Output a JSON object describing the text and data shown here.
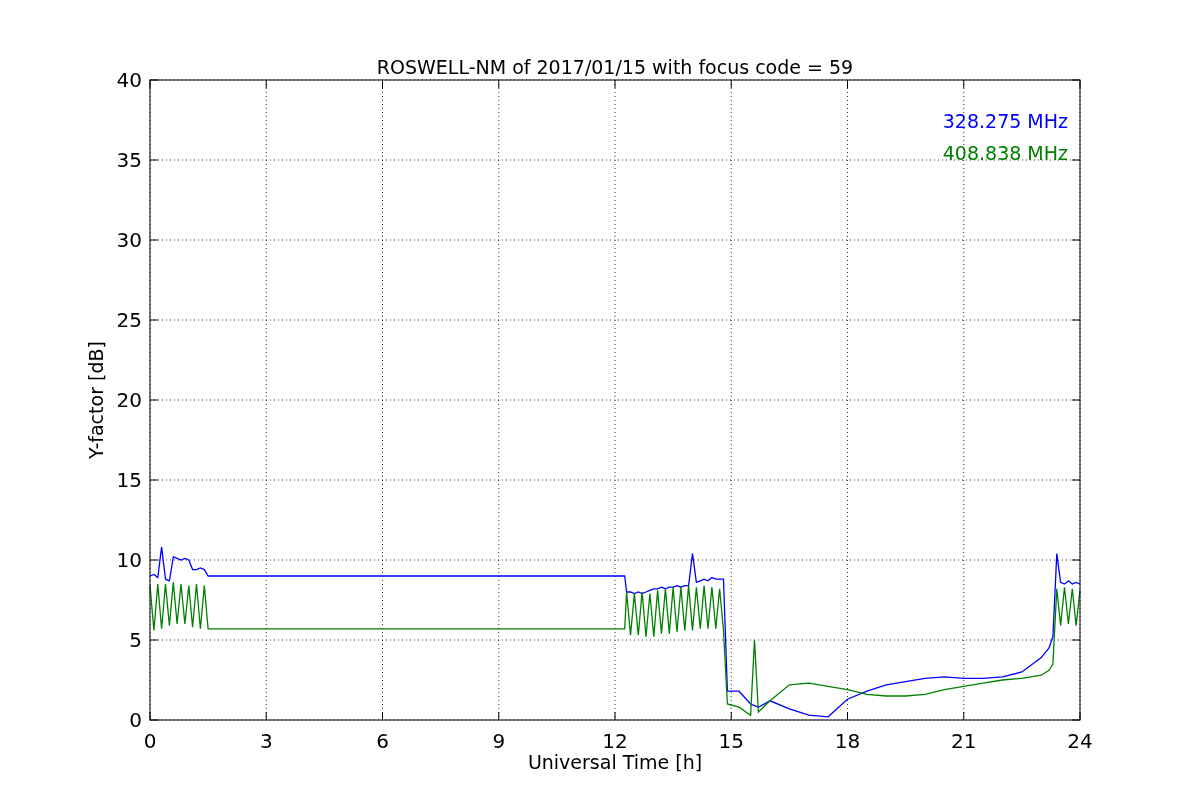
{
  "chart_data": {
    "type": "line",
    "title": "ROSWELL-NM of 2017/01/15 with focus code = 59",
    "xlabel": "Universal Time [h]",
    "ylabel": "Y-factor [dB]",
    "x": [
      0,
      0.1,
      0.2,
      0.3,
      0.4,
      0.5,
      0.6,
      0.7,
      0.8,
      0.9,
      1.0,
      1.1,
      1.2,
      1.3,
      1.4,
      1.5,
      3,
      6,
      9,
      12.25,
      12.3,
      12.4,
      12.5,
      12.6,
      12.7,
      12.8,
      12.9,
      13.0,
      13.1,
      13.2,
      13.3,
      13.4,
      13.5,
      13.6,
      13.7,
      13.8,
      13.9,
      14.0,
      14.1,
      14.2,
      14.3,
      14.4,
      14.5,
      14.6,
      14.7,
      14.8,
      14.9,
      15.2,
      15.5,
      15.6,
      15.7,
      16,
      16.5,
      17,
      17.5,
      18,
      18.5,
      19,
      19.5,
      20,
      20.5,
      21,
      21.5,
      22,
      22.5,
      23,
      23.2,
      23.3,
      23.4,
      23.5,
      23.6,
      23.7,
      23.8,
      23.9,
      24
    ],
    "series": [
      {
        "name": "328.275 MHz",
        "color": "#0000ff",
        "values": [
          9.0,
          9.1,
          8.9,
          10.8,
          8.8,
          8.7,
          10.2,
          10.1,
          10.0,
          10.1,
          10.0,
          9.4,
          9.4,
          9.5,
          9.4,
          9.0,
          9,
          9,
          9,
          9,
          8.0,
          8.0,
          7.9,
          8.0,
          7.9,
          8.0,
          8.1,
          8.2,
          8.2,
          8.3,
          8.2,
          8.3,
          8.3,
          8.4,
          8.3,
          8.4,
          8.4,
          10.4,
          8.6,
          8.7,
          8.8,
          8.7,
          8.9,
          8.8,
          8.8,
          8.8,
          1.8,
          1.8,
          1.0,
          0.9,
          0.8,
          1.2,
          0.7,
          0.3,
          0.2,
          1.3,
          1.8,
          2.2,
          2.4,
          2.6,
          2.7,
          2.6,
          2.6,
          2.7,
          3.0,
          3.9,
          4.5,
          5.2,
          10.4,
          8.6,
          8.5,
          8.7,
          8.5,
          8.6,
          8.5
        ]
      },
      {
        "name": "408.838 MHz",
        "color": "#008000",
        "values": [
          8.4,
          5.6,
          8.5,
          5.7,
          8.5,
          5.9,
          8.6,
          6.0,
          8.5,
          6.0,
          8.4,
          5.8,
          8.5,
          5.7,
          8.4,
          5.7,
          5.7,
          5.7,
          5.7,
          5.7,
          8.0,
          5.3,
          7.9,
          5.3,
          8.0,
          5.2,
          7.9,
          5.2,
          8.1,
          5.4,
          8.2,
          5.4,
          8.3,
          5.5,
          8.3,
          5.6,
          8.4,
          5.6,
          8.3,
          5.7,
          8.4,
          5.7,
          8.3,
          5.7,
          8.2,
          5.6,
          1.0,
          0.8,
          0.3,
          5.0,
          0.5,
          1.2,
          2.2,
          2.3,
          2.1,
          1.9,
          1.6,
          1.5,
          1.5,
          1.6,
          1.9,
          2.1,
          2.3,
          2.5,
          2.6,
          2.8,
          3.1,
          3.5,
          8.2,
          5.9,
          8.3,
          6.0,
          8.2,
          5.9,
          8.1
        ]
      }
    ],
    "xlim": [
      0,
      24
    ],
    "ylim": [
      0,
      40
    ],
    "xticks": [
      0,
      3,
      6,
      9,
      12,
      15,
      18,
      21,
      24
    ],
    "yticks": [
      0,
      5,
      10,
      15,
      20,
      25,
      30,
      35,
      40
    ],
    "grid": true
  }
}
